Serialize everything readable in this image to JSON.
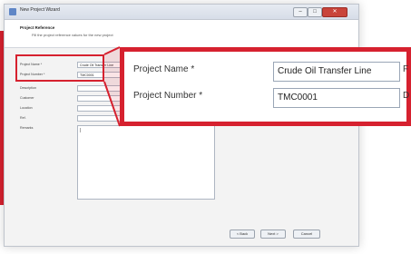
{
  "window": {
    "title": "New Project Wizard",
    "buttons": {
      "minimize": "–",
      "maximize": "□",
      "close": "✕"
    }
  },
  "header": {
    "title": "Project Reference",
    "subtitle": "Fill the project reference values for the new project"
  },
  "form": {
    "project_name_label": "Project Name *",
    "project_name_value": "Crude Oil Transfer Line",
    "project_number_label": "Project Number *",
    "project_number_value": "TMC0001",
    "description_label": "Description",
    "customer_label": "Customer",
    "location_label": "Location",
    "ref_label": "Ref.",
    "remarks_label": "Remarks"
  },
  "footer": {
    "back_label": "< Back",
    "next_label": "Next >",
    "cancel_label": "Cancel"
  },
  "callout": {
    "project_name_label": "Project Name *",
    "project_name_value": "Crude Oil Transfer Line",
    "project_number_label": "Project Number *",
    "project_number_value": "TMC0001",
    "cut_letter_1": "F",
    "cut_letter_2": "D"
  },
  "colors": {
    "accent": "#d6212f",
    "titlebar": "#dde3ec",
    "window_bg": "#f3f3f3"
  },
  "icons": {
    "app": "wizard-app-icon",
    "caret": "text-caret-icon"
  }
}
